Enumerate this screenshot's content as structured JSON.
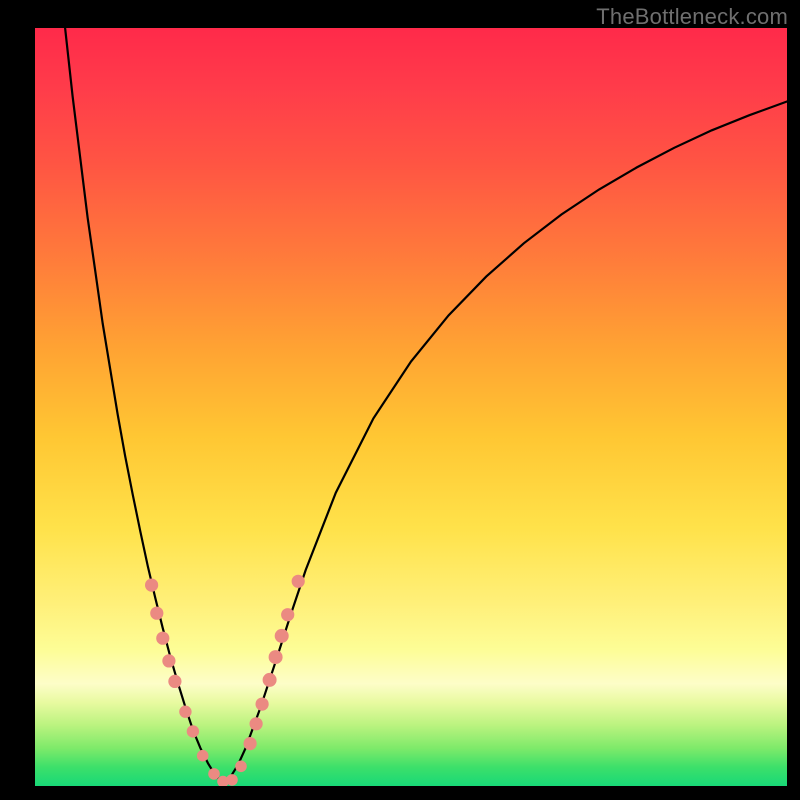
{
  "watermark": "TheBottleneck.com",
  "colors": {
    "frame": "#000000",
    "curve": "#000000",
    "marker": "#eb8a82",
    "gradient_stops": [
      "#ff2a4a",
      "#ff5543",
      "#ffa233",
      "#ffe24a",
      "#fdfd96",
      "#baf37f",
      "#3de06a",
      "#18d877"
    ]
  },
  "chart_data": {
    "type": "line",
    "title": "",
    "xlabel": "",
    "ylabel": "",
    "xlim": [
      0,
      100
    ],
    "ylim": [
      0,
      100
    ],
    "grid": false,
    "legend": false,
    "curve_left": {
      "name": "left-branch",
      "x": [
        4,
        5,
        6,
        7,
        8,
        9,
        10,
        11,
        12,
        13,
        14,
        15,
        16,
        17,
        18,
        19,
        20,
        21,
        22,
        23,
        24,
        25
      ],
      "y": [
        100,
        91,
        83,
        75,
        68,
        61,
        55,
        49,
        43.5,
        38.4,
        33.6,
        29,
        24.8,
        20.8,
        17,
        13.6,
        10.4,
        7.4,
        5,
        3,
        1.4,
        0.5
      ]
    },
    "curve_right": {
      "name": "right-branch",
      "x": [
        25,
        26,
        27,
        28,
        30,
        32,
        34,
        36,
        40,
        45,
        50,
        55,
        60,
        65,
        70,
        75,
        80,
        85,
        90,
        95,
        100
      ],
      "y": [
        0.5,
        1.2,
        2.8,
        5,
        10.4,
        16.4,
        22.6,
        28.5,
        38.7,
        48.5,
        56,
        62.1,
        67.2,
        71.6,
        75.4,
        78.7,
        81.6,
        84.2,
        86.5,
        88.5,
        90.3
      ]
    },
    "markers": {
      "name": "highlight-points",
      "points": [
        {
          "x": 15.5,
          "y": 26.5,
          "r": 1.6
        },
        {
          "x": 16.2,
          "y": 22.8,
          "r": 1.6
        },
        {
          "x": 17.0,
          "y": 19.5,
          "r": 1.6
        },
        {
          "x": 17.8,
          "y": 16.5,
          "r": 1.6
        },
        {
          "x": 18.6,
          "y": 13.8,
          "r": 1.6
        },
        {
          "x": 20.0,
          "y": 9.8,
          "r": 1.5
        },
        {
          "x": 21.0,
          "y": 7.2,
          "r": 1.5
        },
        {
          "x": 22.3,
          "y": 4.0,
          "r": 1.4
        },
        {
          "x": 23.8,
          "y": 1.6,
          "r": 1.4
        },
        {
          "x": 25.0,
          "y": 0.6,
          "r": 1.4
        },
        {
          "x": 26.2,
          "y": 0.8,
          "r": 1.4
        },
        {
          "x": 27.4,
          "y": 2.6,
          "r": 1.4
        },
        {
          "x": 28.6,
          "y": 5.6,
          "r": 1.6
        },
        {
          "x": 29.4,
          "y": 8.2,
          "r": 1.6
        },
        {
          "x": 30.2,
          "y": 10.8,
          "r": 1.6
        },
        {
          "x": 31.2,
          "y": 14.0,
          "r": 1.7
        },
        {
          "x": 32.0,
          "y": 17.0,
          "r": 1.7
        },
        {
          "x": 32.8,
          "y": 19.8,
          "r": 1.7
        },
        {
          "x": 33.6,
          "y": 22.6,
          "r": 1.6
        },
        {
          "x": 35.0,
          "y": 27.0,
          "r": 1.6
        }
      ]
    }
  }
}
